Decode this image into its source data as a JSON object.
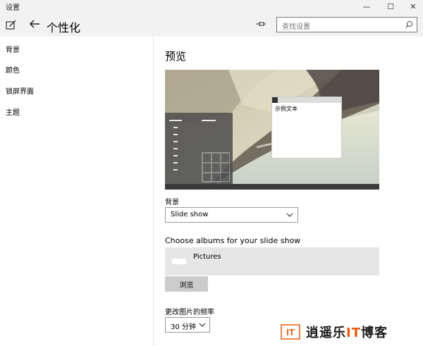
{
  "window": {
    "title": "设置",
    "controls": {
      "minimize": "—",
      "maximize": "☐",
      "close": "✕"
    }
  },
  "header": {
    "page_title": "个性化",
    "search_placeholder": "查找设置"
  },
  "sidebar": {
    "items": [
      {
        "label": "背景"
      },
      {
        "label": "颜色"
      },
      {
        "label": "锁屏界面"
      },
      {
        "label": "主题"
      }
    ]
  },
  "main": {
    "section_title": "预览",
    "preview": {
      "sample_text": "示例文本"
    },
    "background": {
      "label": "背景",
      "selected": "Slide show"
    },
    "albums": {
      "label": "Choose albums for your slide show",
      "album_name": "Pictures",
      "browse_label": "浏览"
    },
    "frequency": {
      "label": "更改图片的频率",
      "selected": "30 分钟"
    }
  },
  "watermark": {
    "logo_text": "IT",
    "text_main": "逍遥乐",
    "text_accent": "IT",
    "text_tail": "博客"
  },
  "colors": {
    "chrome": "#f2f2f2",
    "accent_window": "#333333",
    "album_box": "#e6e6e6",
    "button": "#cccccc",
    "watermark_accent": "#e85a12"
  },
  "icons": {
    "app": "settings-app-icon",
    "back": "back-arrow-icon",
    "pin": "pin-icon",
    "search": "search-icon",
    "chevron": "chevron-down-icon"
  }
}
